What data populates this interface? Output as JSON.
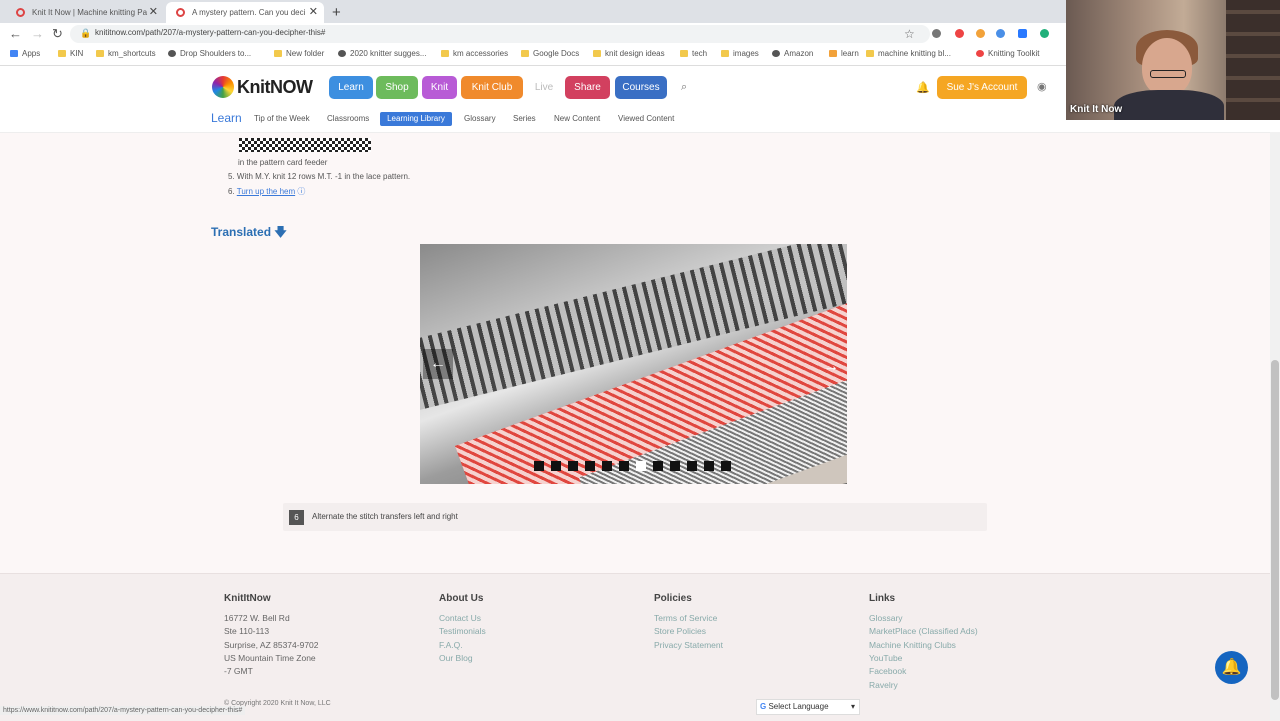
{
  "browser": {
    "tabs": [
      {
        "title": "Knit It Now | Machine knitting Pa",
        "active": false
      },
      {
        "title": "A mystery pattern. Can you deci",
        "active": true
      }
    ],
    "new_tab": "+",
    "url": "knititnow.com/path/207/a-mystery-pattern-can-you-decipher-this#",
    "bookmarks": [
      "Apps",
      "KIN",
      "km_shortcuts",
      "Drop Shoulders to...",
      "New folder",
      "2020 knitter sugges...",
      "km accessories",
      "Google Docs",
      "knit design ideas",
      "tech",
      "images",
      "Amazon",
      "learn",
      "machine knitting bl...",
      "Knitting Toolkit"
    ]
  },
  "header": {
    "logo_text": "KnitNOW",
    "nav": [
      {
        "label": "Learn",
        "color": "#3d8fe0"
      },
      {
        "label": "Shop",
        "color": "#6dbb5c"
      },
      {
        "label": "Knit",
        "color": "#b85bd6"
      },
      {
        "label": "Knit Club",
        "color": "#f08a2c"
      },
      {
        "label": "Live",
        "color": "#ffffff"
      },
      {
        "label": "Share",
        "color": "#d2405f"
      },
      {
        "label": "Courses",
        "color": "#3a6fc4"
      }
    ],
    "account_button": "Sue J's Account",
    "account_color": "#f5a623"
  },
  "subnav": {
    "section": "Learn",
    "items": [
      "Tip of the Week",
      "Classrooms",
      "Learning Library",
      "Glossary",
      "Series",
      "New Content",
      "Viewed Content"
    ],
    "active_index": 2
  },
  "webcam": {
    "label": "Knit It Now"
  },
  "content": {
    "feeder_text": "in the pattern card feeder",
    "step5": "5.  With M.Y. knit 12 rows M.T. -1 in the lace pattern.",
    "step6_prefix": "6.",
    "step6_link": "Turn up the hem",
    "translated_label": "Translated",
    "slider": {
      "total_slides": 12,
      "active_slide": 6
    },
    "step_number": "6",
    "step_text": "Alternate the stitch transfers left and right"
  },
  "footer": {
    "col1": {
      "heading": "KnitItNow",
      "lines": [
        "16772 W. Bell Rd",
        "Ste 110-113",
        "Surprise, AZ 85374-9702",
        "US Mountain Time Zone",
        "-7 GMT"
      ]
    },
    "col2": {
      "heading": "About Us",
      "links": [
        "Contact Us",
        "Testimonials",
        "F.A.Q.",
        "Our Blog"
      ]
    },
    "col3": {
      "heading": "Policies",
      "links": [
        "Terms of Service",
        "Store Policies",
        "Privacy Statement"
      ]
    },
    "col4": {
      "heading": "Links",
      "links": [
        "Glossary",
        "MarketPlace (Classified Ads)",
        "Machine Knitting Clubs",
        "YouTube",
        "Facebook",
        "Ravelry"
      ]
    },
    "copyright": "© Copyright 2020 Knit It Now, LLC",
    "status_url": "https://www.knititnow.com/path/207/a-mystery-pattern-can-you-decipher-this#",
    "language": "Select Language"
  }
}
